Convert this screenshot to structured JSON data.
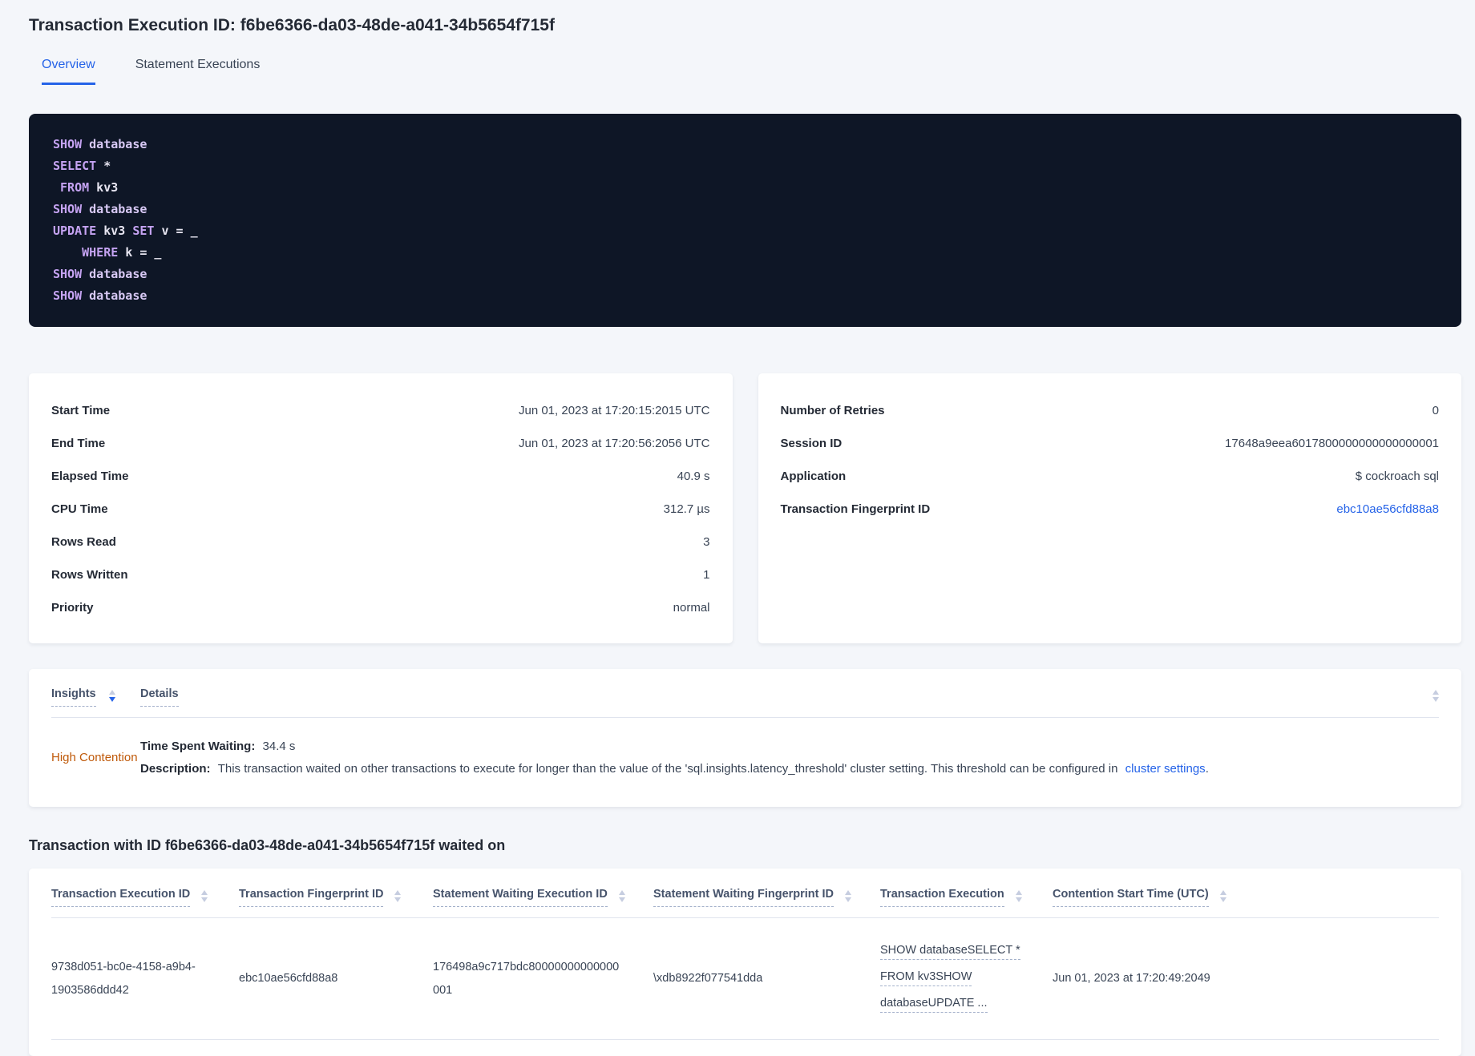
{
  "page": {
    "title": "Transaction Execution ID: f6be6366-da03-48de-a041-34b5654f715f"
  },
  "tabs": [
    {
      "label": "Overview",
      "active": true
    },
    {
      "label": "Statement Executions",
      "active": false
    }
  ],
  "colors": {
    "link_blue": "#2563e8",
    "high_contention_orange": "#bf5909",
    "sql_background": "#0e1626",
    "sql_keyword": "#c5a3f2",
    "sql_identifier": "#e7e5f1"
  },
  "sql": {
    "lines": [
      [
        [
          "kw",
          "SHOW"
        ],
        [
          "pl",
          " "
        ],
        [
          "db",
          "database"
        ]
      ],
      [
        [
          "kw",
          "SELECT"
        ],
        [
          "pl",
          " *"
        ]
      ],
      [
        [
          "pl",
          " "
        ],
        [
          "kw",
          "FROM"
        ],
        [
          "pl",
          " kv3"
        ]
      ],
      [
        [
          "kw",
          "SHOW"
        ],
        [
          "pl",
          " "
        ],
        [
          "db",
          "database"
        ]
      ],
      [
        [
          "kw",
          "UPDATE"
        ],
        [
          "pl",
          " kv3 "
        ],
        [
          "kw",
          "SET"
        ],
        [
          "pl",
          " v = _"
        ]
      ],
      [
        [
          "pl",
          "    "
        ],
        [
          "kw",
          "WHERE"
        ],
        [
          "pl",
          " k = _"
        ]
      ],
      [
        [
          "kw",
          "SHOW"
        ],
        [
          "pl",
          " "
        ],
        [
          "db",
          "database"
        ]
      ],
      [
        [
          "kw",
          "SHOW"
        ],
        [
          "pl",
          " "
        ],
        [
          "db",
          "database"
        ]
      ]
    ]
  },
  "summary_left": {
    "rows": [
      {
        "label": "Start Time",
        "value": "Jun 01, 2023 at 17:20:15:2015 UTC"
      },
      {
        "label": "End Time",
        "value": "Jun 01, 2023 at 17:20:56:2056 UTC"
      },
      {
        "label": "Elapsed Time",
        "value": "40.9 s"
      },
      {
        "label": "CPU Time",
        "value": "312.7 µs"
      },
      {
        "label": "Rows Read",
        "value": "3"
      },
      {
        "label": "Rows Written",
        "value": "1"
      },
      {
        "label": "Priority",
        "value": "normal"
      }
    ]
  },
  "summary_right": {
    "rows": [
      {
        "label": "Number of Retries",
        "value": "0"
      },
      {
        "label": "Session ID",
        "value": "17648a9eea6017800000000000000001"
      },
      {
        "label": "Application",
        "value": "$ cockroach sql"
      },
      {
        "label": "Transaction Fingerprint ID",
        "value": "ebc10ae56cfd88a8"
      }
    ]
  },
  "insights": {
    "columns": [
      {
        "label": "Insights"
      },
      {
        "label": "Details"
      }
    ],
    "row": {
      "insight": "High Contention",
      "waiting_label": "Time Spent Waiting:",
      "waiting_value": "34.4 s",
      "description_label": "Description:",
      "description_text": "This transaction waited on other transactions to execute for longer than the value of the 'sql.insights.latency_threshold' cluster setting. This threshold can be configured in",
      "description_link": "cluster settings",
      "description_suffix": "."
    }
  },
  "waited": {
    "heading": "Transaction with ID f6be6366-da03-48de-a041-34b5654f715f waited on",
    "columns": [
      {
        "label": "Transaction Execution ID"
      },
      {
        "label": "Transaction Fingerprint ID"
      },
      {
        "label": "Statement Waiting Execution ID"
      },
      {
        "label": "Statement Waiting Fingerprint ID"
      },
      {
        "label": "Transaction Execution"
      },
      {
        "label": "Contention Start Time (UTC)"
      }
    ],
    "row": {
      "transaction_execution_id": "9738d051-bc0e-4158-a9b4-1903586ddd42",
      "transaction_fingerprint_id": "ebc10ae56cfd88a8",
      "statement_waiting_execution_id": "176498a9c717bdc80000000000000001",
      "statement_waiting_fingerprint_id": "\\xdb8922f077541dda",
      "transaction_execution_lines": [
        "SHOW databaseSELECT *",
        "FROM kv3SHOW",
        "databaseUPDATE ..."
      ],
      "contention_start_time": "Jun 01, 2023 at 17:20:49:2049"
    }
  }
}
